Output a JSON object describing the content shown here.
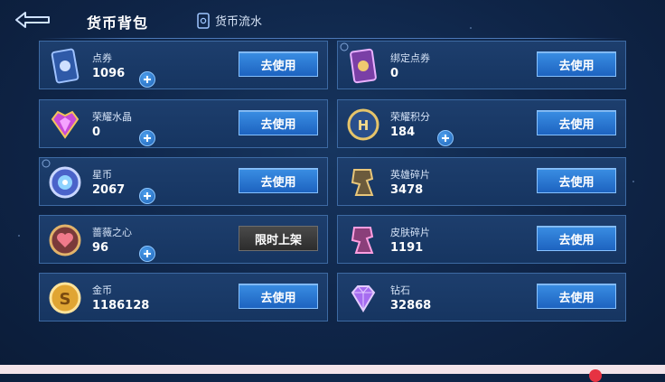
{
  "header": {
    "title": "货币背包",
    "flow_label": "货币流水"
  },
  "currencies": [
    {
      "name": "点券",
      "amount": "1096",
      "button": "去使用"
    },
    {
      "name": "绑定点券",
      "amount": "0",
      "button": "去使用"
    },
    {
      "name": "荣耀水晶",
      "amount": "0",
      "button": "去使用"
    },
    {
      "name": "荣耀积分",
      "amount": "184",
      "button": "去使用"
    },
    {
      "name": "星币",
      "amount": "2067",
      "button": "去使用"
    },
    {
      "name": "英雄碎片",
      "amount": "3478",
      "button": "去使用"
    },
    {
      "name": "蔷薇之心",
      "amount": "96",
      "button": "限时上架"
    },
    {
      "name": "皮肤碎片",
      "amount": "1191",
      "button": "去使用"
    },
    {
      "name": "金币",
      "amount": "1186128",
      "button": "去使用"
    },
    {
      "name": "钻石",
      "amount": "32868",
      "button": "去使用"
    }
  ],
  "icons": {
    "back": "back-arrow-icon",
    "flow": "ledger-icon",
    "items": [
      "voucher-card-icon",
      "bound-voucher-card-icon",
      "glory-crystal-icon",
      "glory-points-icon",
      "star-coin-icon",
      "hero-fragment-icon",
      "rose-heart-icon",
      "skin-fragment-icon",
      "gold-coin-icon",
      "diamond-icon"
    ]
  }
}
